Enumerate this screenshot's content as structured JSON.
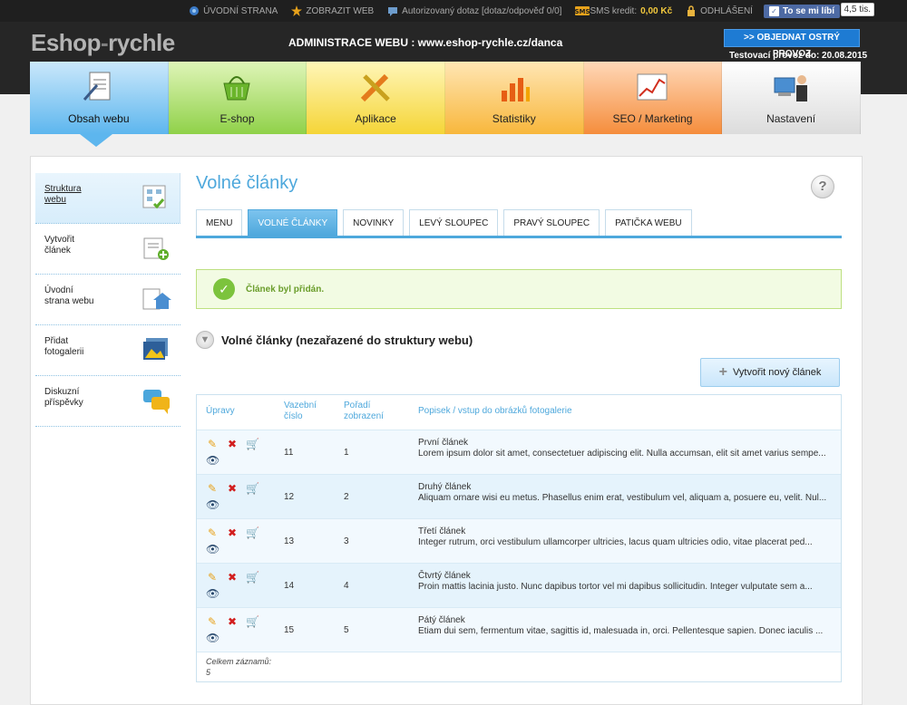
{
  "topbar": {
    "homepage": "ÚVODNÍ STRANA",
    "view_web": "ZOBRAZIT WEB",
    "auth_query": "Autorizovaný dotaz [dotaz/odpověď 0/0]",
    "sms_label": "SMS kredit:",
    "sms_value": "0,00 Kč",
    "logout": "ODHLÁŠENÍ",
    "fb_like": "To se mi líbí",
    "fb_count": "4,5 tis."
  },
  "header": {
    "logo_left": "Eshop",
    "logo_dash": "-",
    "logo_right": "rychle",
    "admin_title": "ADMINISTRACE WEBU : www.eshop-rychle.cz/danca",
    "order_button": ">> OBJEDNAT OSTRÝ PROVOZ",
    "test_info": "Testovací provoz do: 20.08.2015"
  },
  "mainnav": [
    {
      "label": "Obsah webu"
    },
    {
      "label": "E-shop"
    },
    {
      "label": "Aplikace"
    },
    {
      "label": "Statistiky"
    },
    {
      "label": "SEO / Marketing"
    },
    {
      "label": "Nastavení"
    }
  ],
  "sidebar": [
    {
      "line1": "Struktura",
      "line2": "webu"
    },
    {
      "line1": "Vytvořit",
      "line2": "článek"
    },
    {
      "line1": "Úvodní",
      "line2": "strana webu"
    },
    {
      "line1": "Přidat",
      "line2": "fotogalerii"
    },
    {
      "line1": "Diskuzní",
      "line2": "příspěvky"
    }
  ],
  "main": {
    "page_title": "Volné články",
    "help": "?",
    "tabs": [
      "MENU",
      "VOLNÉ ČLÁNKY",
      "NOVINKY",
      "LEVÝ SLOUPEC",
      "PRAVÝ SLOUPEC",
      "PATIČKA WEBU"
    ],
    "notice": "Článek byl přidán.",
    "section_title": "Volné články (nezařazené do struktury webu)",
    "create_button": "Vytvořit nový článek"
  },
  "table": {
    "headers": {
      "actions": "Úpravy",
      "link1": "Vazební",
      "link2": "číslo",
      "order1": "Pořadí",
      "order2": "zobrazení",
      "desc": "Popisek / vstup do obrázků fotogalerie"
    },
    "rows": [
      {
        "id": "11",
        "order": "1",
        "title": "První článek",
        "text": "Lorem ipsum dolor sit amet, consectetuer adipiscing elit. Nulla accumsan, elit sit amet varius sempe..."
      },
      {
        "id": "12",
        "order": "2",
        "title": "Druhý článek",
        "text": "Aliquam ornare wisi eu metus. Phasellus enim erat, vestibulum vel, aliquam a, posuere eu, velit. Nul..."
      },
      {
        "id": "13",
        "order": "3",
        "title": "Třetí článek",
        "text": "Integer rutrum, orci vestibulum ullamcorper ultricies, lacus quam ultricies odio, vitae placerat ped..."
      },
      {
        "id": "14",
        "order": "4",
        "title": "Čtvrtý článek",
        "text": "Proin mattis lacinia justo. Nunc dapibus tortor vel mi dapibus sollicitudin. Integer vulputate sem a..."
      },
      {
        "id": "15",
        "order": "5",
        "title": "Pátý článek",
        "text": "Etiam dui sem, fermentum vitae, sagittis id, malesuada in, orci. Pellentesque sapien. Donec iaculis ..."
      }
    ],
    "footer_label": "Celkem záznamů:",
    "footer_count": "5"
  },
  "icons": {
    "edit": "pencil-icon",
    "delete": "delete-icon",
    "cart": "cart-icon",
    "view": "eye-icon"
  }
}
